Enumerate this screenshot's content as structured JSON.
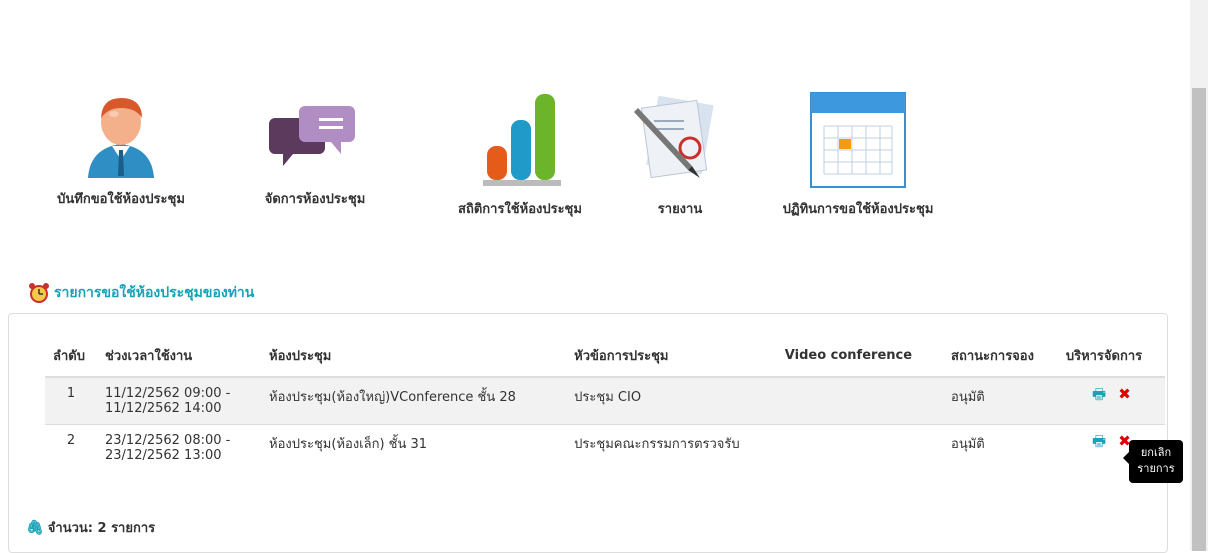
{
  "menu": [
    {
      "label": "บันทึกขอใช้ห้องประชุม",
      "icon": "user-avatar-icon"
    },
    {
      "label": "จัดการห้องประชุม",
      "icon": "chat-bubbles-icon"
    },
    {
      "label": "สถิติการใช้ห้องประชุม",
      "icon": "bar-chart-icon"
    },
    {
      "label": "รายงาน",
      "icon": "document-pen-icon"
    },
    {
      "label": "ปฏิทินการขอใช้ห้องประชุม",
      "icon": "calendar-icon"
    }
  ],
  "section": {
    "title": "รายการขอใช้ห้องประชุมของท่าน",
    "icon": "alarm-clock-icon"
  },
  "table": {
    "headers": [
      "ลำดับ",
      "ช่วงเวลาใช้งาน",
      "ห้องประชุม",
      "หัวข้อการประชุม",
      "Video conference",
      "สถานะการจอง",
      "บริหารจัดการ"
    ],
    "rows": [
      {
        "no": "1",
        "time_start": "11/12/2562 09:00 -",
        "time_end": "11/12/2562 14:00",
        "room": "ห้องประชุม(ห้องใหญ่)VConference ชั้น 28",
        "topic": "ประชุม CIO",
        "video": "",
        "status": "อนุมัติ"
      },
      {
        "no": "2",
        "time_start": "23/12/2562 08:00 -",
        "time_end": "23/12/2562 13:00",
        "room": "ห้องประชุม(ห้องเล็ก) ชั้น 31",
        "topic": "ประชุมคณะกรรมการตรวจรับ",
        "video": "",
        "status": "อนุมัติ"
      }
    ],
    "action_icons": {
      "print": "printer-icon",
      "cancel": "close-icon"
    }
  },
  "tooltip": {
    "line1": "ยกเลิก",
    "line2": "รายการ"
  },
  "footer": {
    "count_label": "จำนวน: 2 รายการ",
    "icon": "paperclip-icon"
  },
  "colors": {
    "accent": "#16a2b8",
    "danger": "#e00000",
    "row_alt": "#f2f2f2"
  }
}
